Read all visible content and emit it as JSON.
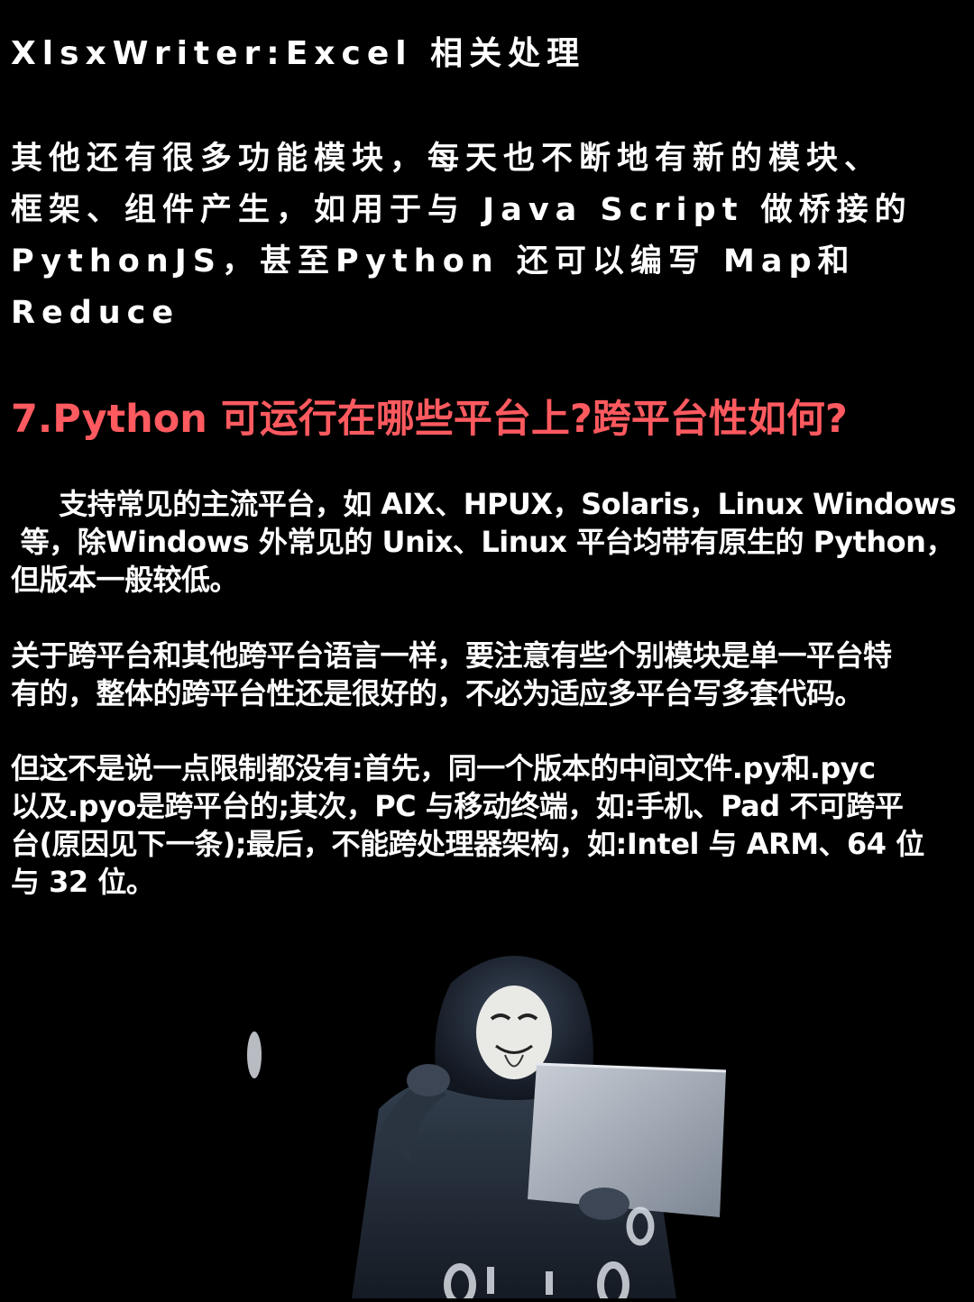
{
  "colors": {
    "background": "#000000",
    "text": "#ffffff",
    "heading": "#ff5a5f"
  },
  "top_title": "XlsxWriter:Excel 相关处理",
  "intro_lines": [
    "其他还有很多功能模块，每天也不断地有新的模块、",
    "框架、组件产生，如用于与 Java Script 做桥接的",
    "PythonJS，甚至Python 还可以编写 Map和",
    "Reduce"
  ],
  "section_heading": "7.Python 可运行在哪些平台上?跨平台性如何?",
  "paragraphs": [
    {
      "lines": [
        "     支持常见的主流平台，如 AIX、HPUX，Solaris，Linux Windows",
        " 等，除Windows 外常见的 Unix、Linux 平台均带有原生的 Python，",
        "但版本一般较低。"
      ]
    },
    {
      "lines": [
        "关于跨平台和其他跨平台语言一样，要注意有些个别模块是单一平台特",
        "有的，整体的跨平台性还是很好的，不必为适应多平台写多套代码。"
      ]
    },
    {
      "lines": [
        "但这不是说一点限制都没有:首先，同一个版本的中间文件.py和.pyc",
        "以及.pyo是跨平台的;其次，PC 与移动终端，如:手机、Pad 不可跨平",
        "台(原因见下一条);最后，不能跨处理器架构，如:Intel 与 ARM、64 位",
        "与 32 位。"
      ]
    }
  ]
}
